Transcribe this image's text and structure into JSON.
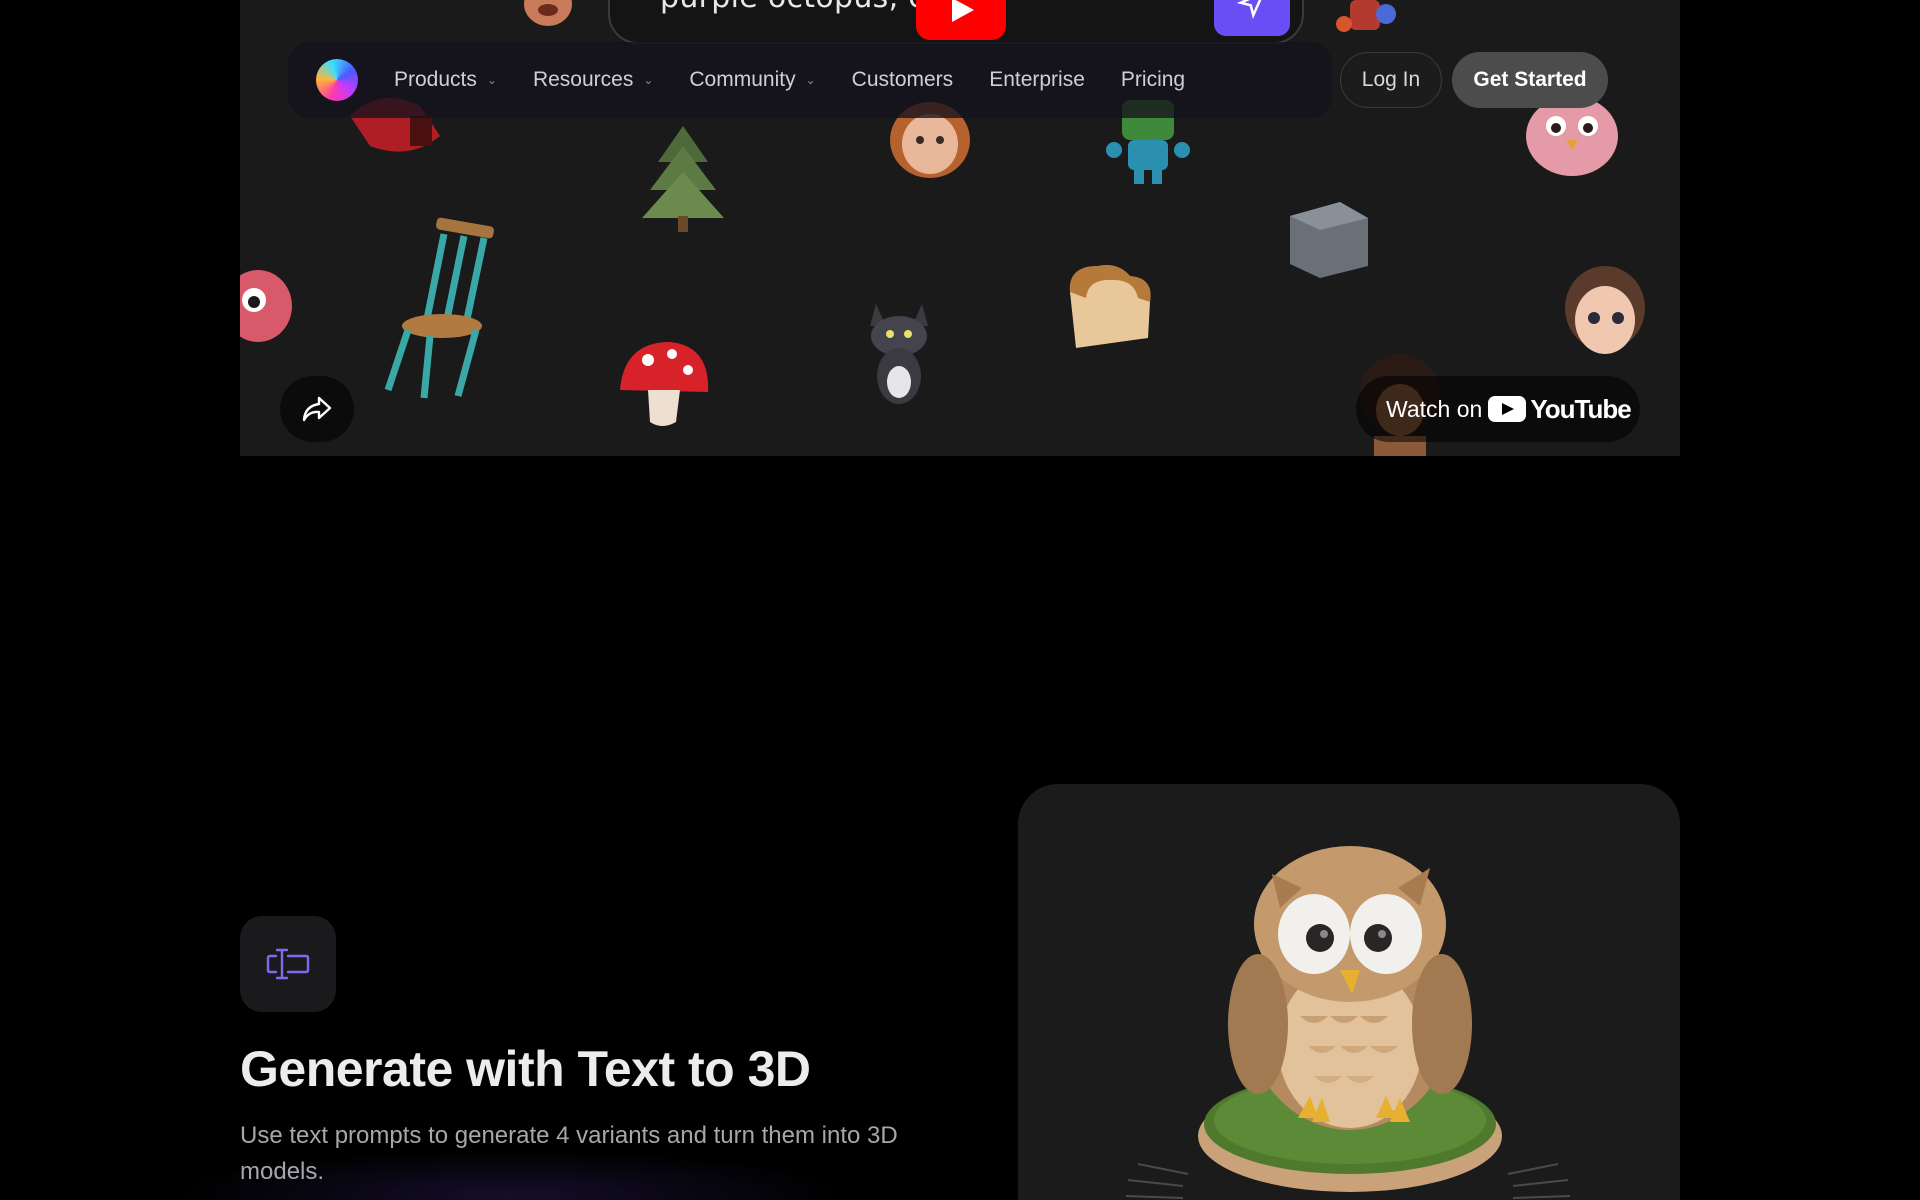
{
  "video": {
    "prompt_text": "purple octopus, c",
    "share_icon": "share-arrow-icon",
    "watch_on": "Watch on",
    "youtube_word": "YouTube"
  },
  "nav": {
    "items": [
      {
        "label": "Products",
        "has_dropdown": true
      },
      {
        "label": "Resources",
        "has_dropdown": true
      },
      {
        "label": "Community",
        "has_dropdown": true
      },
      {
        "label": "Customers",
        "has_dropdown": false
      },
      {
        "label": "Enterprise",
        "has_dropdown": false
      },
      {
        "label": "Pricing",
        "has_dropdown": false
      }
    ],
    "login": "Log In",
    "get_started": "Get Started"
  },
  "feature": {
    "icon": "text-cursor-icon",
    "title": "Generate with Text to 3D",
    "description": "Use text prompts to generate 4 variants and turn them into 3D models."
  },
  "colors": {
    "accent": "#6a4ef5",
    "youtube_red": "#ff0000",
    "icon_purple": "#7b6cf0"
  }
}
